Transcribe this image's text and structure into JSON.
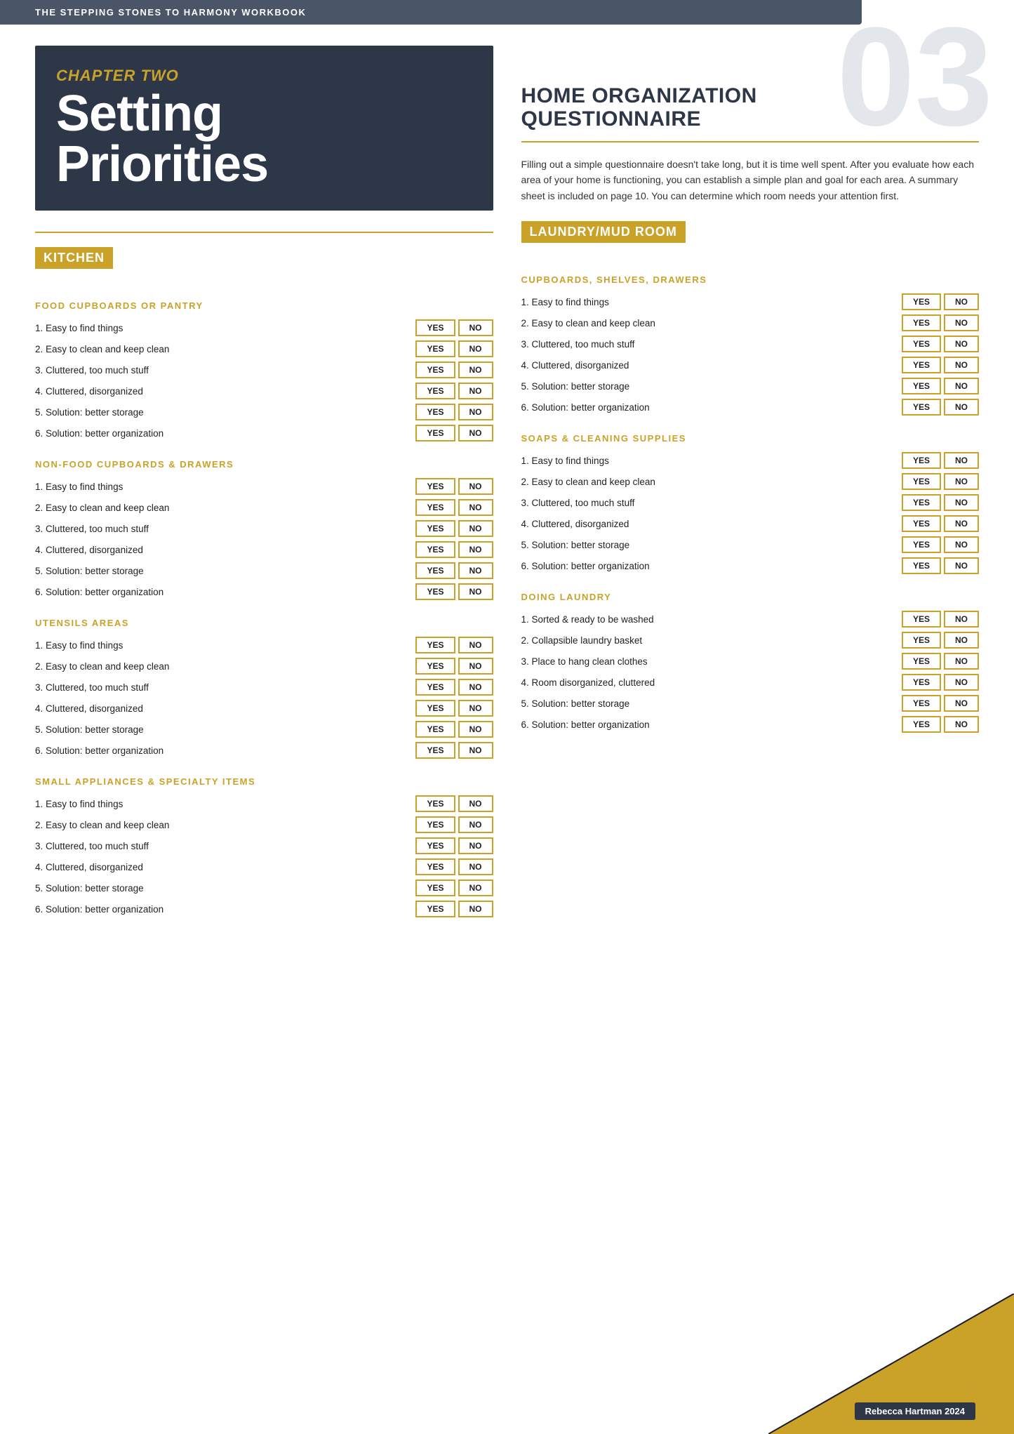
{
  "banner": {
    "text": "THE STEPPING STONES TO HARMONY WORKBOOK"
  },
  "watermark": "03",
  "chapter": {
    "label": "CHAPTER TWO",
    "title": "Setting\nPriorities"
  },
  "page_title_line1": "HOME ORGANIZATION",
  "page_title_line2": "QUESTIONNAIRE",
  "intro_text": "Filling out a simple questionnaire doesn't take long, but it is time well spent. After you evaluate how each area of your home is functioning, you can establish a simple plan and goal for each area. A summary sheet is included on page 10. You can determine which room needs your attention first.",
  "kitchen_heading": "KITCHEN",
  "laundry_heading": "LAUNDRY/MUD ROOM",
  "sections": {
    "food_cupboards": {
      "heading": "FOOD CUPBOARDS OR PANTRY",
      "items": [
        "1. Easy to find things",
        "2. Easy to clean and keep clean",
        "3. Cluttered, too much stuff",
        "4. Cluttered, disorganized",
        "5. Solution: better storage",
        "6. Solution: better organization"
      ]
    },
    "non_food": {
      "heading": "NON-FOOD CUPBOARDS & DRAWERS",
      "items": [
        "1. Easy to find things",
        "2. Easy to clean and keep clean",
        "3. Cluttered, too much stuff",
        "4. Cluttered, disorganized",
        "5. Solution: better storage",
        "6. Solution: better organization"
      ]
    },
    "utensils": {
      "heading": "UTENSILS AREAS",
      "items": [
        "1. Easy to find things",
        "2. Easy to clean and keep clean",
        "3. Cluttered, too much stuff",
        "4. Cluttered, disorganized",
        "5. Solution: better storage",
        "6. Solution: better organization"
      ]
    },
    "small_appliances": {
      "heading": "SMALL APPLIANCES & SPECIALTY ITEMS",
      "items": [
        "1. Easy to find things",
        "2. Easy to clean and keep clean",
        "3. Cluttered, too much stuff",
        "4. Cluttered, disorganized",
        "5. Solution: better storage",
        "6. Solution: better organization"
      ]
    },
    "cupboards_shelves": {
      "heading": "CUPBOARDS, SHELVES, DRAWERS",
      "items": [
        "1. Easy to find things",
        "2. Easy to clean and keep clean",
        "3. Cluttered, too much stuff",
        "4. Cluttered, disorganized",
        "5. Solution: better storage",
        "6. Solution: better organization"
      ]
    },
    "soaps_cleaning": {
      "heading": "SOAPS & CLEANING SUPPLIES",
      "items": [
        "1. Easy to find things",
        "2. Easy to clean and keep clean",
        "3. Cluttered, too much stuff",
        "4. Cluttered, disorganized",
        "5. Solution: better storage",
        "6. Solution: better organization"
      ]
    },
    "doing_laundry": {
      "heading": "DOING LAUNDRY",
      "items": [
        "1. Sorted & ready to be washed",
        "2. Collapsible laundry basket",
        "3. Place to hang clean clothes",
        "4. Room disorganized, cluttered",
        "5. Solution: better storage",
        "6. Solution: better organization"
      ]
    }
  },
  "buttons": {
    "yes": "YES",
    "no": "NO"
  },
  "footer": {
    "credit": "Rebecca Hartman 2024"
  }
}
